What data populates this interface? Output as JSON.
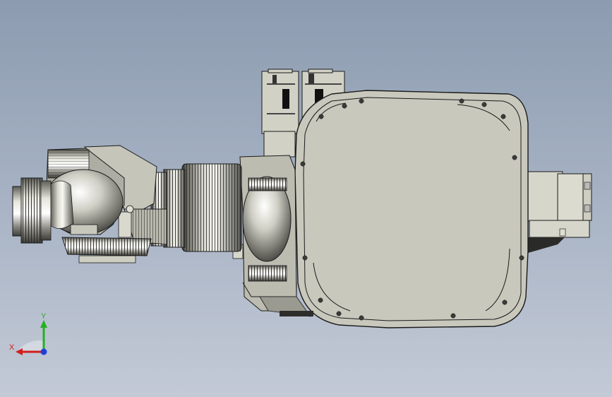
{
  "triad": {
    "x_label": "X",
    "y_label": "Y",
    "x_color": "#d21e1e",
    "y_color": "#23b023",
    "z_color": "#1f3fd8"
  },
  "colors": {
    "background_top": "#8c9bb0",
    "background_bottom": "#c3cad6",
    "part_fill": "#c9c8bd",
    "part_stroke": "#1a1a1a"
  }
}
